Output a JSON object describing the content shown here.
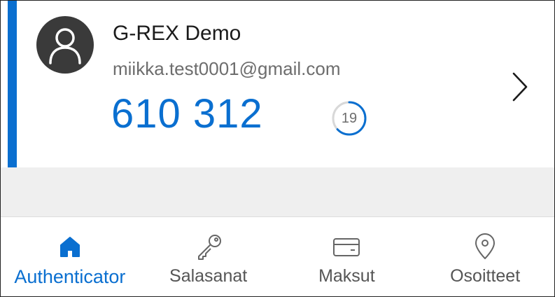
{
  "account": {
    "name": "G-REX Demo",
    "email": "miikka.test0001@gmail.com",
    "otp_code": "610 312",
    "timer_seconds": "19",
    "timer_progress": 0.63,
    "avatar_icon": "person-icon",
    "open_icon": "chevron-right-icon"
  },
  "nav": {
    "items": [
      {
        "label": "Authenticator",
        "icon": "home-icon",
        "active": true
      },
      {
        "label": "Salasanat",
        "icon": "key-icon",
        "active": false
      },
      {
        "label": "Maksut",
        "icon": "card-icon",
        "active": false
      },
      {
        "label": "Osoitteet",
        "icon": "location-pin-icon",
        "active": false
      }
    ]
  },
  "colors": {
    "accent": "#0a6fd0",
    "avatar_bg": "#3a3a3a",
    "band": "#efefef"
  }
}
